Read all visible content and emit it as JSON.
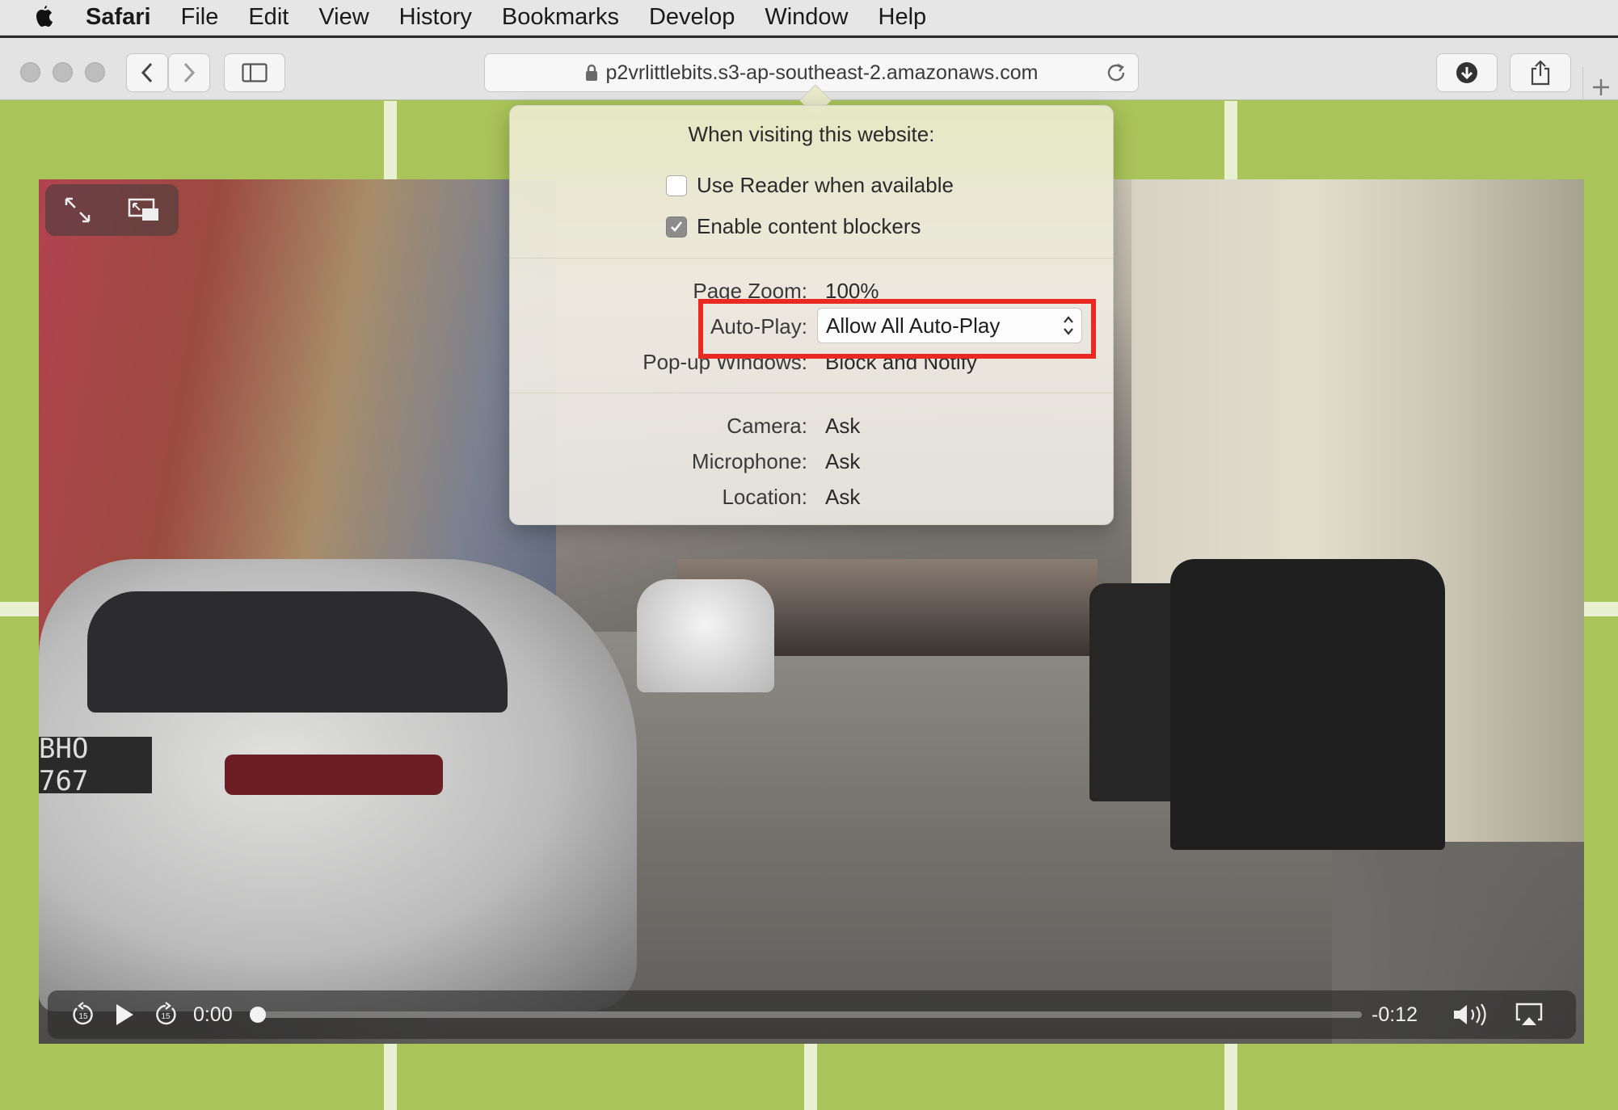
{
  "menubar": {
    "app_name": "Safari",
    "items": [
      "File",
      "Edit",
      "View",
      "History",
      "Bookmarks",
      "Develop",
      "Window",
      "Help"
    ]
  },
  "toolbar": {
    "url": "p2vrlittlebits.s3-ap-southeast-2.amazonaws.com"
  },
  "popover": {
    "title": "When visiting this website:",
    "use_reader": {
      "label": "Use Reader when available",
      "checked": false
    },
    "content_blockers": {
      "label": "Enable content blockers",
      "checked": true
    },
    "page_zoom": {
      "label": "Page Zoom:",
      "value": "100%"
    },
    "auto_play": {
      "label": "Auto-Play:",
      "value": "Allow All Auto-Play"
    },
    "popup_windows": {
      "label": "Pop-up Windows:",
      "value": "Block and Notify"
    },
    "camera": {
      "label": "Camera:",
      "value": "Ask"
    },
    "microphone": {
      "label": "Microphone:",
      "value": "Ask"
    },
    "location": {
      "label": "Location:",
      "value": "Ask"
    }
  },
  "video": {
    "plate": "BHO 767",
    "elapsed": "0:00",
    "remaining": "-0:12",
    "progress": 0.0
  },
  "colors": {
    "highlight": "#ea2a22",
    "page_background": "#a9c459"
  }
}
